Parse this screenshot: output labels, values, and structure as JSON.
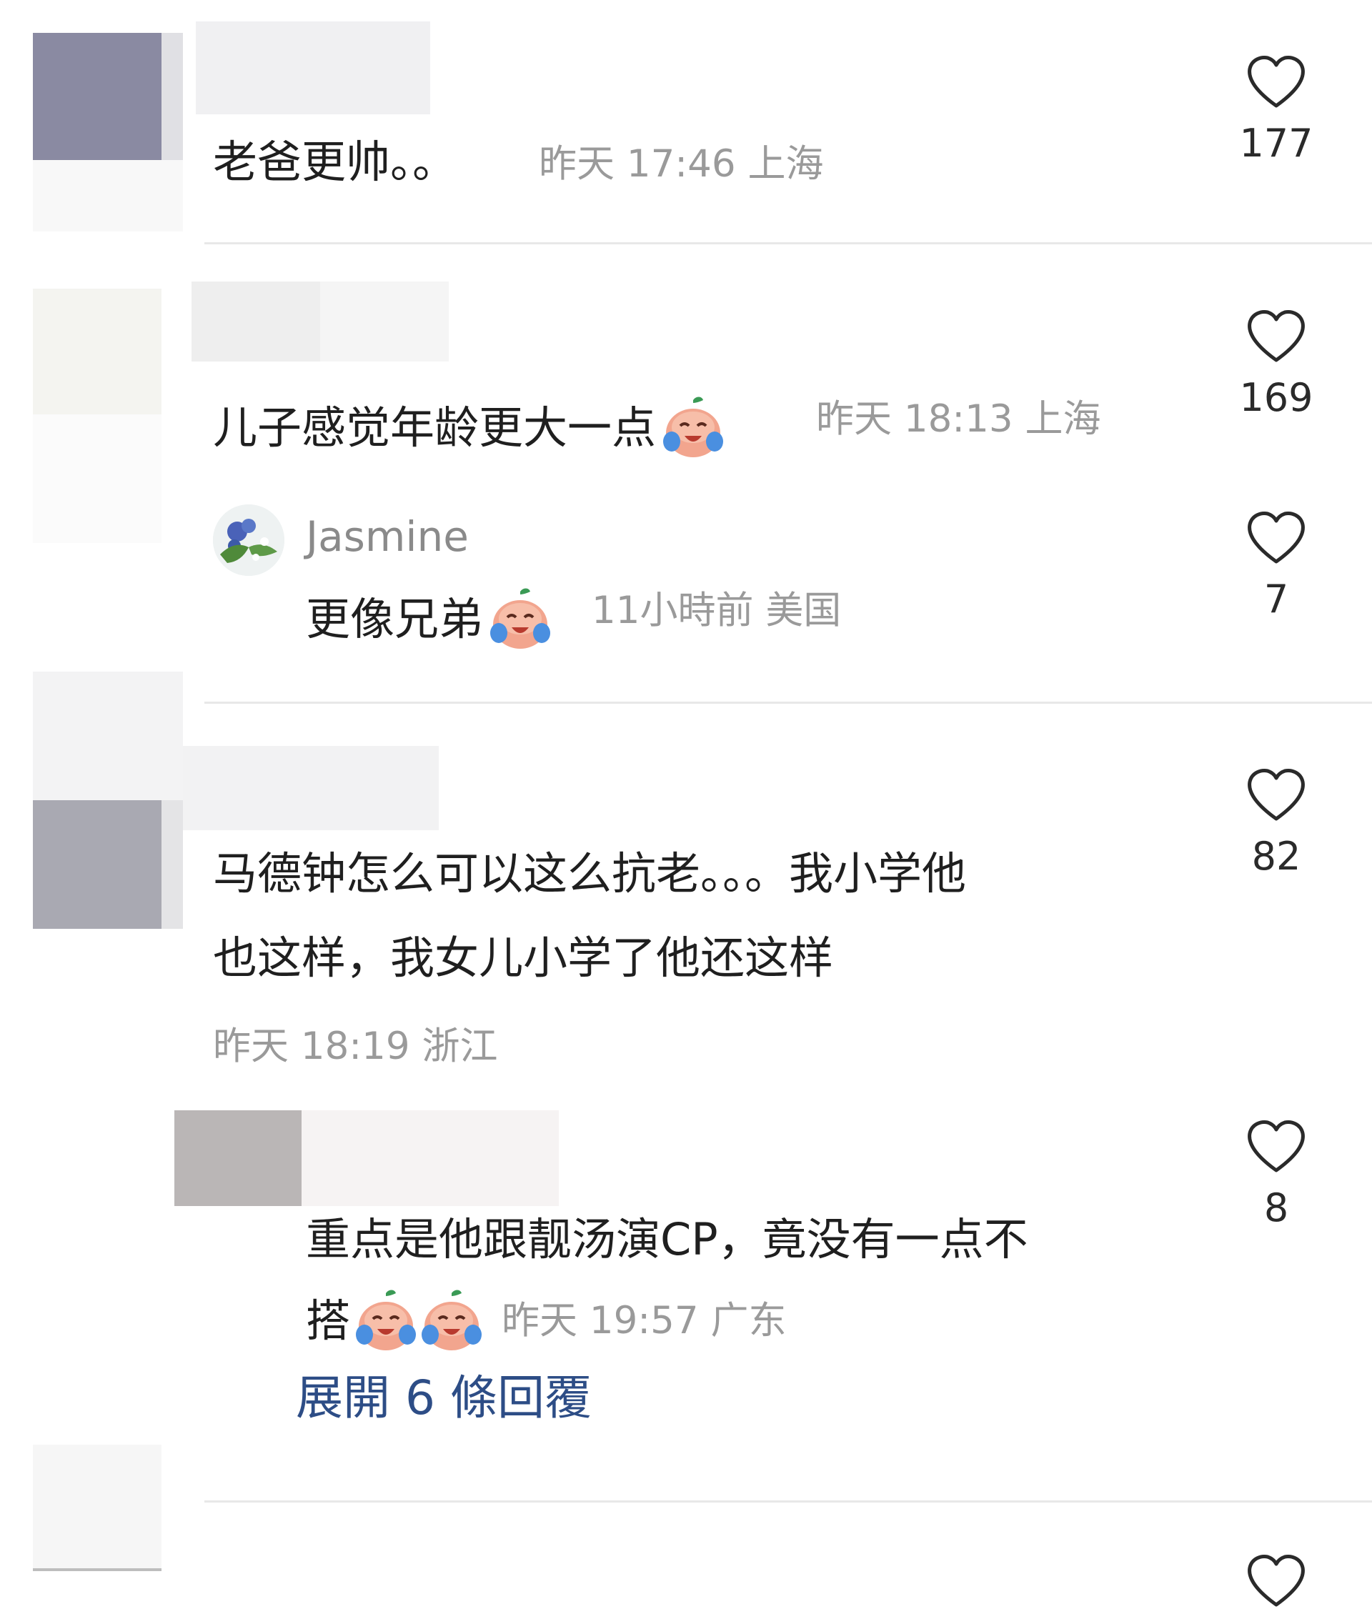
{
  "comments": [
    {
      "text": "老爸更帅。。",
      "time": "昨天 17:46",
      "location": "上海",
      "likes": "177"
    },
    {
      "text": "儿子感觉年龄更大一点",
      "time": "昨天 18:13",
      "location": "上海",
      "likes": "169",
      "replies": [
        {
          "author": "Jasmine",
          "text": "更像兄弟",
          "time": "11小時前",
          "location": "美国",
          "likes": "7"
        }
      ]
    },
    {
      "text_line1": "马德钟怎么可以这么抗老。。。我小学他",
      "text_line2": "也这样，我女儿小学了他还这样",
      "time": "昨天 18:19",
      "location": "浙江",
      "likes": "82",
      "replies": [
        {
          "text_line1": "重点是他跟靓汤演CP，竟没有一点不",
          "text_line2": "搭",
          "time": "昨天 19:57",
          "location": "广东",
          "likes": "8"
        }
      ],
      "expand_label": "展開 6 條回覆"
    }
  ],
  "icons": {
    "like": "heart-outline-icon",
    "emoji": "crying-laughing-peach-emoji"
  },
  "colors": {
    "link": "#2d4d86",
    "meta": "#9a9a9a"
  }
}
